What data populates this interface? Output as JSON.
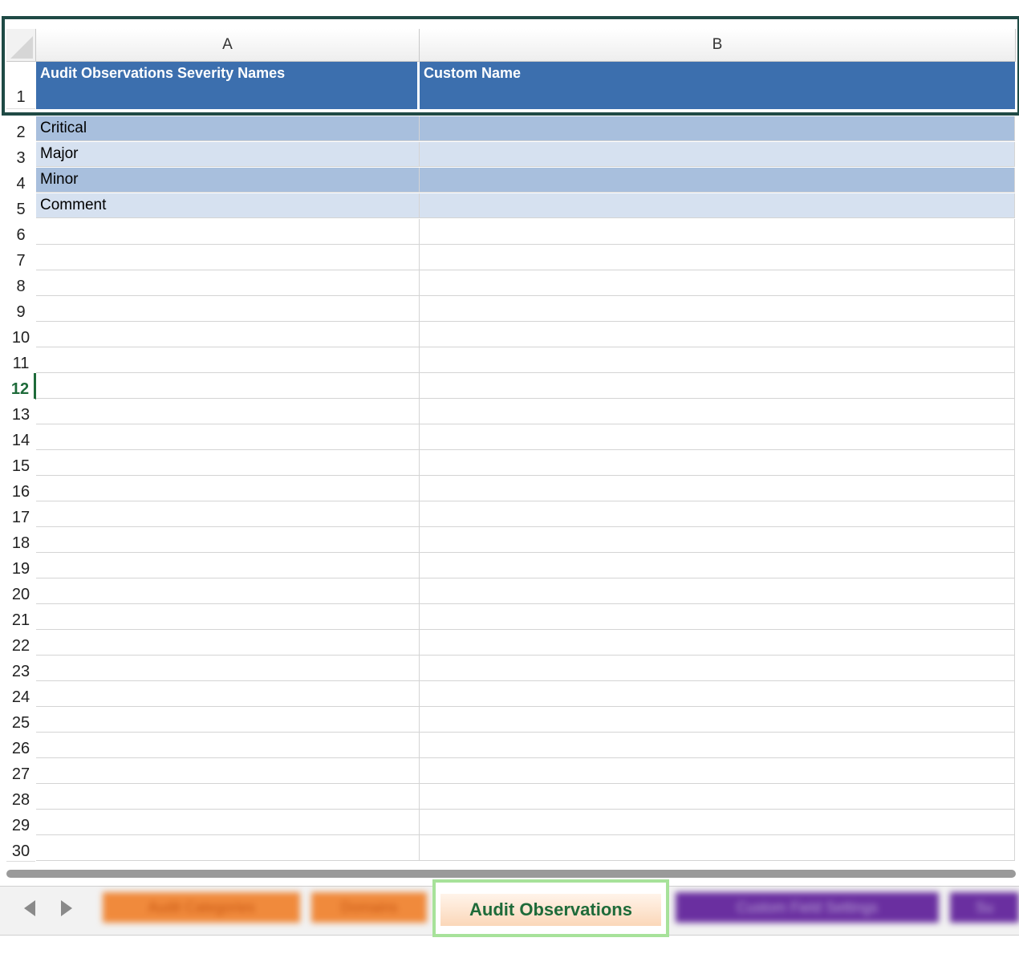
{
  "columns": {
    "a": "A",
    "b": "B"
  },
  "header_row": {
    "num": "1",
    "col_a": "Audit Observations Severity Names",
    "col_b": "Custom Name"
  },
  "rows": [
    {
      "num": "2",
      "a": "Critical",
      "b": ""
    },
    {
      "num": "3",
      "a": "Major",
      "b": ""
    },
    {
      "num": "4",
      "a": "Minor",
      "b": ""
    },
    {
      "num": "5",
      "a": "Comment",
      "b": ""
    }
  ],
  "row_numbers": [
    "6",
    "7",
    "8",
    "9",
    "10",
    "11",
    "12",
    "13",
    "14",
    "15",
    "16",
    "17",
    "18",
    "19",
    "20",
    "21",
    "22",
    "23",
    "24",
    "25",
    "26",
    "27",
    "28",
    "29",
    "30"
  ],
  "active_row": "12",
  "tabs": [
    {
      "label": "Audit Categories",
      "color": "#f08a3c",
      "blurred": true
    },
    {
      "label": "Domains",
      "color": "#f08a3c",
      "blurred": true
    },
    {
      "label": "Audit Observations",
      "color": "#fbd7b9",
      "active": true
    },
    {
      "label": "Custom Field Settings",
      "color": "#6a2fa0",
      "blurred": true
    },
    {
      "label": "Su",
      "color": "#6a2fa0",
      "blurred": true
    }
  ],
  "colors": {
    "header_fill": "#3c6fae",
    "band_dark": "#a8bfdd",
    "band_light": "#d6e1f0",
    "selection_border": "#1f4a45",
    "active_tab_text": "#1e6b3a",
    "active_tab_outline": "#a7e29a"
  },
  "icons": {
    "prev": "chevron-left-icon",
    "next": "chevron-right-icon"
  }
}
